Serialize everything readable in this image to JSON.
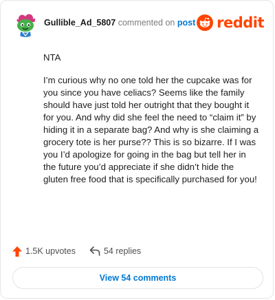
{
  "comment": {
    "username": "Gullible_Ad_5807",
    "action_text": "commented on",
    "post_link": "post",
    "brand": "reddit",
    "paragraphs": [
      "NTA",
      "I’m curious why no one told her the cupcake was for you since you have celiacs? Seems like the family should have just told her outright that they bought it for you. And why did she feel the need to “claim it” by hiding it in a separate bag? And why is she claiming a grocery tote is her purse?? This is so bizarre. If I was you I’d apologize for going in the bag but tell her in the future you’d appreciate if she didn’t hide the gluten free food that is specifically purchased for you!"
    ],
    "upvotes": "1.5K upvotes",
    "replies": "54 replies",
    "view_comments": "View 54 comments"
  },
  "colors": {
    "brand": "#ff4500",
    "link": "#0079d3",
    "upvote": "#ff4500"
  },
  "icons": {
    "avatar": "snoo-avatar",
    "logo": "reddit-logo-icon",
    "upvote": "upvote-arrow-icon",
    "reply": "reply-arrow-icon"
  }
}
